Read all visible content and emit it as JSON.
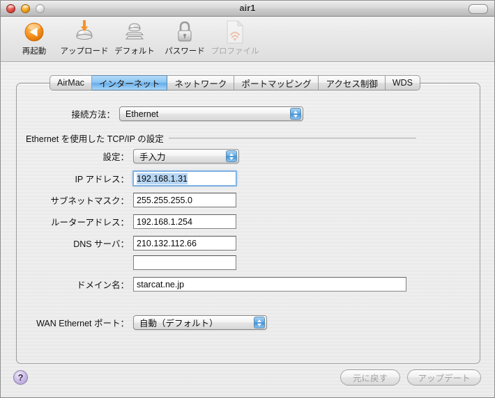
{
  "window": {
    "title": "air1",
    "traffic_lights": [
      "close",
      "minimize",
      "zoom"
    ],
    "toolbar_toggle": "toolbar-toggle"
  },
  "toolbar": {
    "items": [
      {
        "label": "再起動",
        "icon": "restart-icon",
        "disabled": false
      },
      {
        "label": "アップロード",
        "icon": "upload-icon",
        "disabled": false
      },
      {
        "label": "デフォルト",
        "icon": "default-icon",
        "disabled": false
      },
      {
        "label": "パスワード",
        "icon": "password-icon",
        "disabled": false
      },
      {
        "label": "プロファイル",
        "icon": "profile-icon",
        "disabled": true
      }
    ]
  },
  "tabs": [
    {
      "label": "AirMac",
      "active": false
    },
    {
      "label": "インターネット",
      "active": true
    },
    {
      "label": "ネットワーク",
      "active": false
    },
    {
      "label": "ポートマッピング",
      "active": false
    },
    {
      "label": "アクセス制御",
      "active": false
    },
    {
      "label": "WDS",
      "active": false
    }
  ],
  "form": {
    "connection_method": {
      "label": "接続方法：",
      "value": "Ethernet"
    },
    "section_title": "Ethernet を使用した TCP/IP の設定",
    "config": {
      "label": "設定：",
      "value": "手入力"
    },
    "ip_address": {
      "label": "IP アドレス：",
      "value": "192.168.1.31",
      "focused": true
    },
    "subnet_mask": {
      "label": "サブネットマスク：",
      "value": "255.255.255.0",
      "focused": false
    },
    "router": {
      "label": "ルーターアドレス：",
      "value": "192.168.1.254",
      "focused": false
    },
    "dns_primary": {
      "label": "DNS サーバ：",
      "value": "210.132.112.66",
      "focused": false
    },
    "dns_secondary": {
      "label": "",
      "value": "",
      "focused": false
    },
    "domain_name": {
      "label": "ドメイン名：",
      "value": "starcat.ne.jp",
      "focused": false
    },
    "wan_port": {
      "label": "WAN Ethernet ポート：",
      "value": "自動（デフォルト）"
    }
  },
  "footer": {
    "help_label": "?",
    "revert_label": "元に戻す",
    "update_label": "アップデート"
  },
  "colors": {
    "accent_blue": "#65aeec",
    "selection_blue": "#b6d6f4",
    "orange": "#f7931e",
    "help_purple": "#a995d2"
  }
}
